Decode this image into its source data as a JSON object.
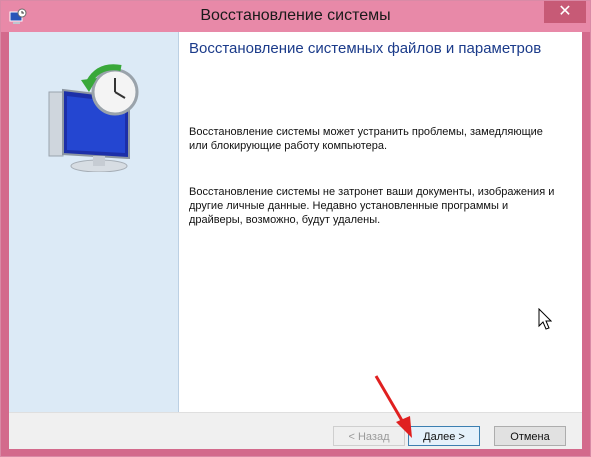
{
  "window": {
    "title": "Восстановление системы",
    "close_label": "✕"
  },
  "page": {
    "heading": "Восстановление системных файлов и параметров",
    "paragraph1": "Восстановление системы может устранить проблемы, замедляющие или блокирующие работу компьютера.",
    "paragraph2": "Восстановление системы не затронет ваши документы, изображения и другие личные данные. Недавно установленные программы и драйверы, возможно, будут удалены."
  },
  "buttons": {
    "back": "< Назад",
    "next": "Далее >",
    "cancel": "Отмена"
  },
  "icons": {
    "title_icon": "system-restore-icon",
    "illustration": "computer-with-clock-restore-icon",
    "cursor": "mouse-pointer-icon",
    "annotation": "red-arrow-icon"
  },
  "colors": {
    "titlebar": "#e889a8",
    "close_button": "#c75a76",
    "sidebar": "#dceaf6",
    "heading": "#1b3b8a",
    "annotation_arrow": "#e02020"
  }
}
